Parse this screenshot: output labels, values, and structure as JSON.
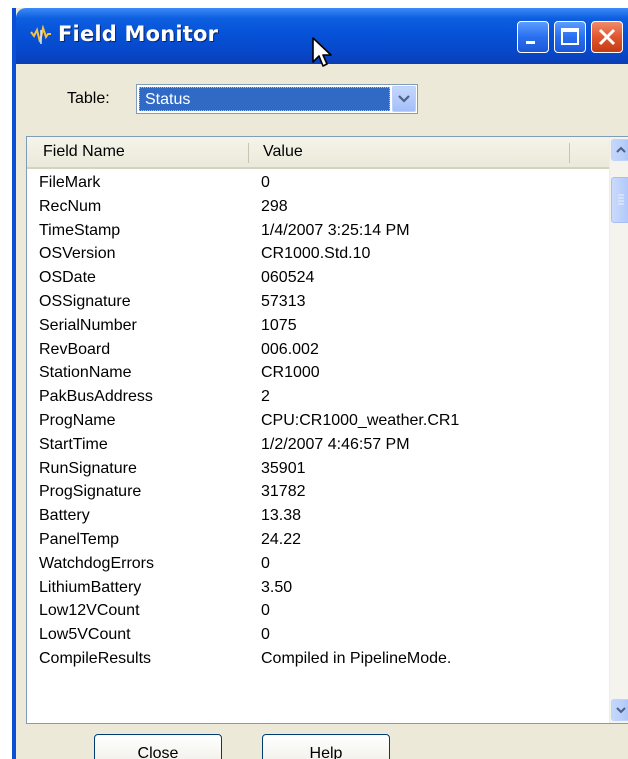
{
  "window": {
    "title": "Field Monitor",
    "controls": [
      "minimize",
      "maximize",
      "close"
    ]
  },
  "table_selector": {
    "label": "Table:",
    "selected": "Status"
  },
  "grid": {
    "columns": [
      "Field Name",
      "Value"
    ],
    "rows": [
      {
        "name": "FileMark",
        "value": "0"
      },
      {
        "name": "RecNum",
        "value": "298"
      },
      {
        "name": "TimeStamp",
        "value": "1/4/2007 3:25:14 PM"
      },
      {
        "name": "OSVersion",
        "value": "CR1000.Std.10"
      },
      {
        "name": "OSDate",
        "value": "060524"
      },
      {
        "name": "OSSignature",
        "value": "57313"
      },
      {
        "name": "SerialNumber",
        "value": "1075"
      },
      {
        "name": "RevBoard",
        "value": "006.002"
      },
      {
        "name": "StationName",
        "value": "CR1000"
      },
      {
        "name": "PakBusAddress",
        "value": "2"
      },
      {
        "name": "ProgName",
        "value": "CPU:CR1000_weather.CR1"
      },
      {
        "name": "StartTime",
        "value": "1/2/2007 4:46:57 PM"
      },
      {
        "name": "RunSignature",
        "value": "35901"
      },
      {
        "name": "ProgSignature",
        "value": "31782"
      },
      {
        "name": "Battery",
        "value": "13.38"
      },
      {
        "name": "PanelTemp",
        "value": "24.22"
      },
      {
        "name": "WatchdogErrors",
        "value": "0"
      },
      {
        "name": "LithiumBattery",
        "value": "3.50"
      },
      {
        "name": "Low12VCount",
        "value": "0"
      },
      {
        "name": "Low5VCount",
        "value": "0"
      },
      {
        "name": "CompileResults",
        "value": "Compiled in PipelineMode."
      }
    ]
  },
  "buttons": {
    "close": "Close",
    "help": "Help"
  },
  "colors": {
    "titlebar": "#0652d8",
    "selection": "#316ac5",
    "dialog_bg": "#ece9d8"
  }
}
